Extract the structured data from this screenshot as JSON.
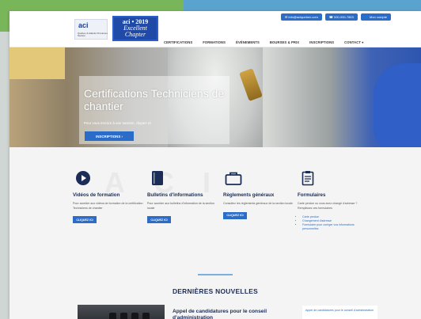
{
  "brand": {
    "logo_text": "aci",
    "logo_subtitle": "Québec & Atlantic Provinces Section",
    "badge_line1": "aci • 2019",
    "badge_line2": "Excellent",
    "badge_line3": "Chapter"
  },
  "topbar": {
    "email": "✉ info@aciquebec.com",
    "phone": "☎ 000-000-7803",
    "account": "👤 Mon compte"
  },
  "nav": {
    "items": [
      "CERTIFICATIONS",
      "FORMATIONS",
      "ÉVÉNEMENTS",
      "BOURSES & PRIX",
      "INSCRIPTIONS",
      "CONTACT ▾"
    ]
  },
  "hero": {
    "title": "Certifications Techniciens de chantier",
    "subtitle": "Pour vous inscrire à une session, cliquez ici",
    "button": "INSCRIPTIONS ›"
  },
  "features": {
    "watermark": [
      "A",
      "C",
      "I"
    ],
    "columns": [
      {
        "icon": "play-circle-icon",
        "title": "Vidéos de formation",
        "text": "Pour accéder aux vidéos de formation de la certification Techniciens de chantier",
        "button": "CLIQUEZ ICI"
      },
      {
        "icon": "book-icon",
        "title": "Bulletins d'informations",
        "text": "Pour accéder aux bulletins d'information de la section locale",
        "button": "CLIQUEZ ICI"
      },
      {
        "icon": "briefcase-icon",
        "title": "Règlements généraux",
        "text": "Consultez les règlements généraux de la section locale",
        "button": "CLIQUEZ ICI"
      },
      {
        "icon": "clipboard-icon",
        "title": "Formulaires",
        "text": "Carte perdue ou vous avez changé d'adresse ? Remplissez ces formulaires",
        "links": [
          "Carte perdue",
          "Changement d'adresse",
          "Formulaire pour corriger vos informations personnelles"
        ]
      }
    ]
  },
  "news": {
    "heading": "DERNIÈRES NOUVELLES",
    "item_title": "Appel de candidatures pour le conseil d'administration",
    "side_links": [
      "Appel de candidatures pour le conseil d'administration"
    ]
  },
  "colors": {
    "primary": "#2a6cc7",
    "navy": "#1b2c57",
    "badge": "#1f4aa8"
  }
}
